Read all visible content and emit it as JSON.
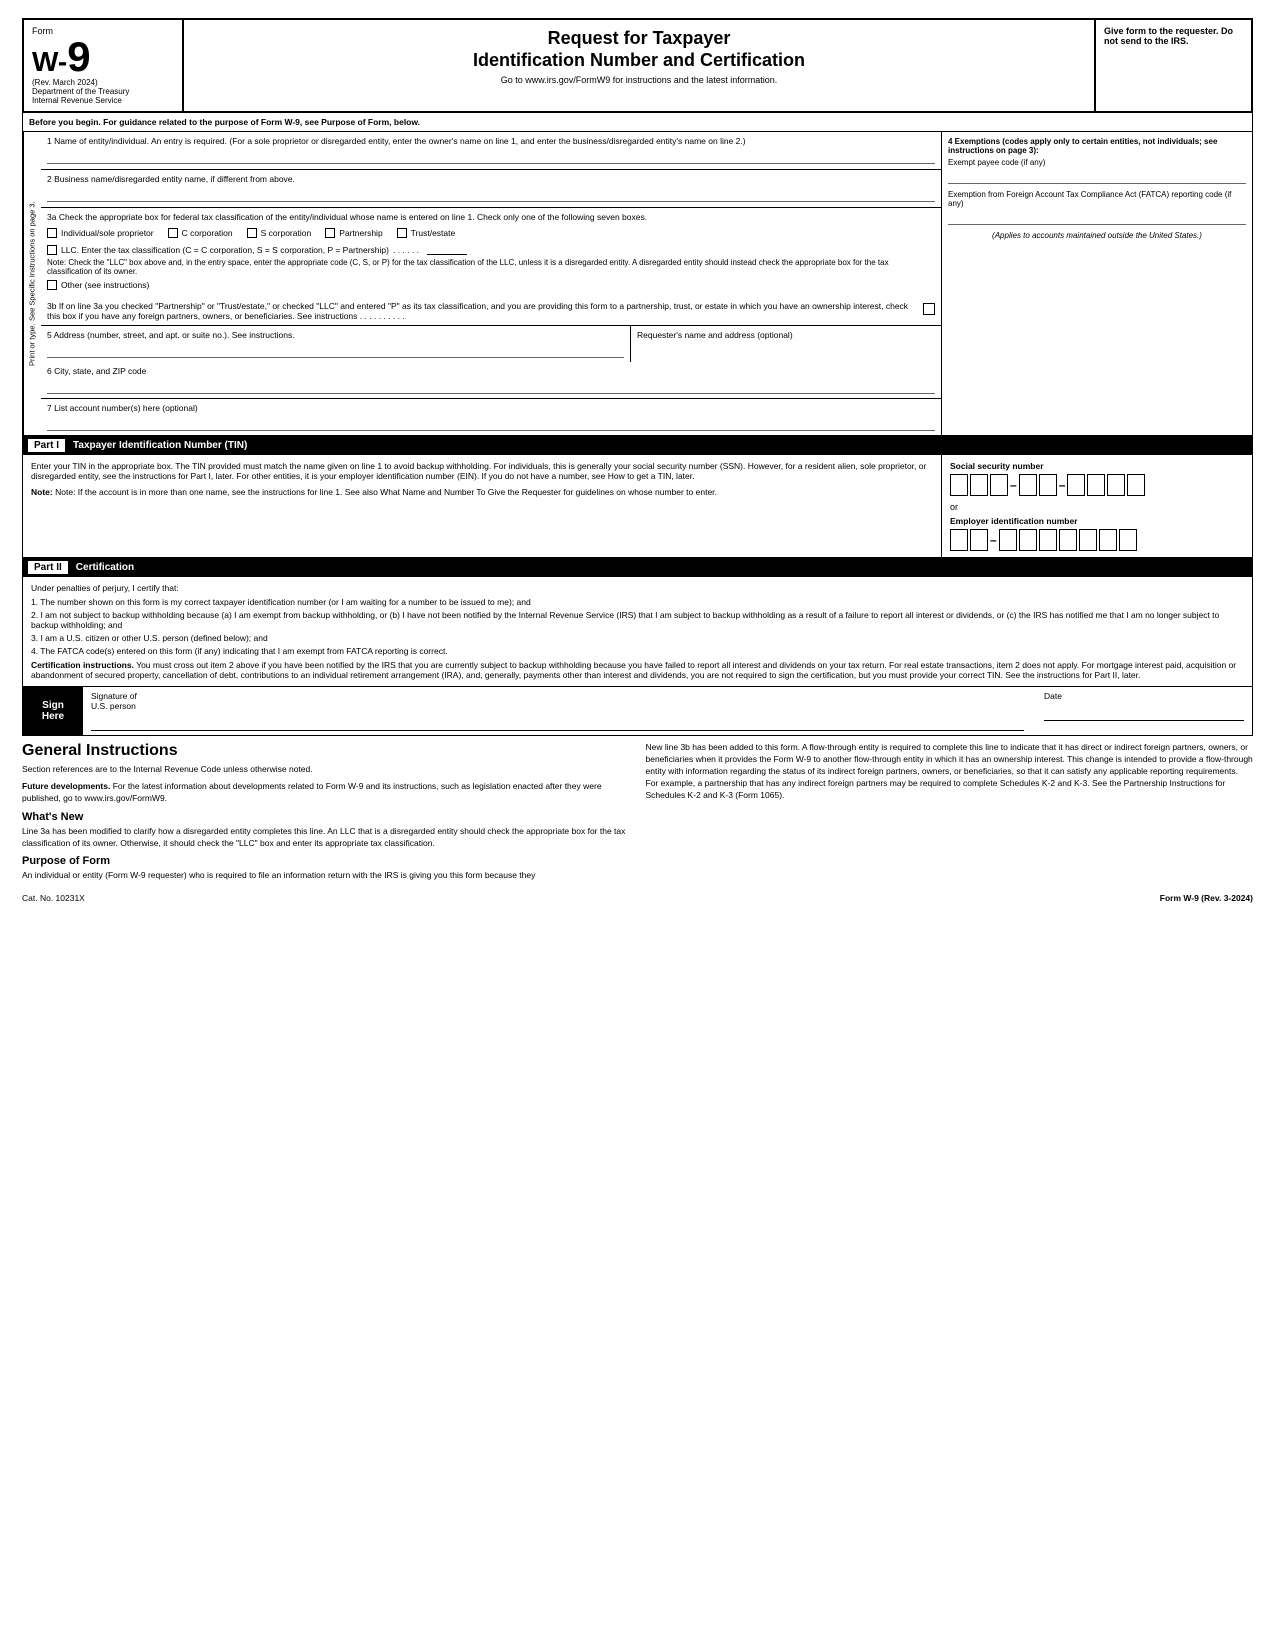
{
  "header": {
    "form_label": "Form",
    "form_number": "W",
    "form_number2": "9",
    "rev_date": "(Rev. March 2024)",
    "dept": "Department of the Treasury",
    "irs": "Internal Revenue Service",
    "title_line1": "Request for Taxpayer",
    "title_line2": "Identification Number and Certification",
    "url_text": "Go to www.irs.gov/FormW9 for instructions and the latest information.",
    "give_form": "Give form to the requester. Do not send to the IRS."
  },
  "before_begin": {
    "text": "Before you begin. For guidance related to the purpose of Form W-9, see Purpose of Form, below."
  },
  "fields": {
    "f1_label": "1  Name of entity/individual. An entry is required. (For a sole proprietor or disregarded entity, enter the owner's name on line 1, and enter the business/disregarded entity's name on line 2.)",
    "f2_label": "2  Business name/disregarded entity name, if different from above.",
    "f3a_label": "3a Check the appropriate box for federal tax classification of the entity/individual whose name is entered on line 1. Check only one of the following seven boxes.",
    "cb_individual": "Individual/sole proprietor",
    "cb_ccorp": "C corporation",
    "cb_scorp": "S corporation",
    "cb_partnership": "Partnership",
    "cb_trust": "Trust/estate",
    "cb_llc_label": "LLC. Enter the tax classification (C = C corporation, S = S corporation, P = Partnership)",
    "cb_llc_dots": ". . . . . .",
    "note_llc": "Note: Check the \"LLC\" box above and, in the entry space, enter the appropriate code (C, S, or P) for the tax classification of the LLC, unless it is a disregarded entity. A disregarded entity should instead check the appropriate box for the tax classification of its owner.",
    "cb_other": "Other (see instructions)",
    "f3b_text": "3b If on line 3a you checked \"Partnership\" or \"Trust/estate,\" or checked \"LLC\" and entered \"P\" as its tax classification, and you are providing this form to a partnership, trust, or estate in which you have an ownership interest, check this box if you have any foreign partners, owners, or beneficiaries. See instructions",
    "f3b_dots": ". . . . . . . . . .",
    "f5_label": "5  Address (number, street, and apt. or suite no.). See instructions.",
    "f5_optional": "Requester's name and address (optional)",
    "f6_label": "6  City, state, and ZIP code",
    "f7_label": "7  List account number(s) here (optional)"
  },
  "side_label": {
    "line1": "See Specific Instructions on page 3.",
    "line2": "Print or type."
  },
  "exemptions": {
    "title": "4 Exemptions (codes apply only to certain entities, not individuals; see instructions on page 3):",
    "exempt_payee": "Exempt payee code (if any)",
    "fatca_label": "Exemption from Foreign Account Tax Compliance Act (FATCA) reporting code (if any)",
    "applies_note": "(Applies to accounts maintained outside the United States.)"
  },
  "part1": {
    "label": "Part I",
    "title": "Taxpayer Identification Number (TIN)",
    "instructions": "Enter your TIN in the appropriate box. The TIN provided must match the name given on line 1 to avoid backup withholding. For individuals, this is generally your social security number (SSN). However, for a resident alien, sole proprietor, or disregarded entity, see the instructions for Part I, later. For other entities, it is your employer identification number (EIN). If you do not have a number, see How to get a TIN, later.",
    "note": "Note: If the account is in more than one name, see the instructions for line 1. See also What Name and Number To Give the Requester for guidelines on whose number to enter.",
    "ssn_label": "Social security number",
    "or_text": "or",
    "ein_label": "Employer identification number"
  },
  "part2": {
    "label": "Part II",
    "title": "Certification",
    "intro": "Under penalties of perjury, I certify that:",
    "item1": "1. The number shown on this form is my correct taxpayer identification number (or I am waiting for a number to be issued to me); and",
    "item2": "2. I am not subject to backup withholding because (a) I am exempt from backup withholding, or (b) I have not been notified by the Internal Revenue Service (IRS) that I am subject to backup withholding as a result of a failure to report all interest or dividends, or (c) the IRS has notified me that I am no longer subject to backup withholding; and",
    "item3": "3. I am a U.S. citizen or other U.S. person (defined below); and",
    "item4": "4. The FATCA code(s) entered on this form (if any) indicating that I am exempt from FATCA reporting is correct.",
    "cert_instructions_bold": "Certification instructions.",
    "cert_instructions": " You must cross out item 2 above if you have been notified by the IRS that you are currently subject to backup withholding because you have failed to report all interest and dividends on your tax return. For real estate transactions, item 2 does not apply. For mortgage interest paid, acquisition or abandonment of secured property, cancellation of debt, contributions to an individual retirement arrangement (IRA), and, generally, payments other than interest and dividends, you are not required to sign the certification, but you must provide your correct TIN. See the instructions for Part II, later."
  },
  "sign_here": {
    "label_line1": "Sign",
    "label_line2": "Here",
    "sig_label": "Signature of",
    "sig_sub": "U.S. person",
    "date_label": "Date"
  },
  "general": {
    "heading": "General Instructions",
    "para1": "Section references are to the Internal Revenue Code unless otherwise noted.",
    "future_bold": "Future developments.",
    "future_text": " For the latest information about developments related to Form W-9 and its instructions, such as legislation enacted after they were published, go to www.irs.gov/FormW9.",
    "whats_new_heading": "What's New",
    "whats_new_text": "Line 3a has been modified to clarify how a disregarded entity completes this line. An LLC that is a disregarded entity should check the appropriate box for the tax classification of its owner. Otherwise, it should check the \"LLC\" box and enter its appropriate tax classification.",
    "purpose_heading": "Purpose of Form",
    "purpose_text": "An individual or entity (Form W-9 requester) who is required to file an information return with the IRS is giving you this form because they"
  },
  "right_col": {
    "new_line_text": "New line 3b has been added to this form. A flow-through entity is required to complete this line to indicate that it has direct or indirect foreign partners, owners, or beneficiaries when it provides the Form W-9 to another flow-through entity in which it has an ownership interest. This change is intended to provide a flow-through entity with information regarding the status of its indirect foreign partners, owners, or beneficiaries, so that it can satisfy any applicable reporting requirements. For example, a partnership that has any indirect foreign partners may be required to complete Schedules K-2 and K-3. See the Partnership Instructions for Schedules K-2 and K-3 (Form 1065)."
  },
  "footer": {
    "cat_no": "Cat. No. 10231X",
    "form_label": "Form W-9 (Rev. 3-2024)"
  }
}
